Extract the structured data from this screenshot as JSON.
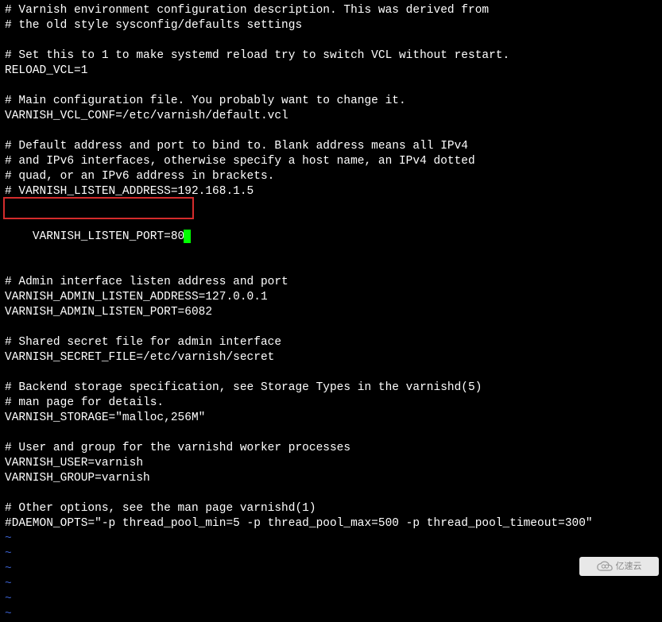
{
  "editor": {
    "lines": [
      "# Varnish environment configuration description. This was derived from",
      "# the old style sysconfig/defaults settings",
      "",
      "# Set this to 1 to make systemd reload try to switch VCL without restart.",
      "RELOAD_VCL=1",
      "",
      "# Main configuration file. You probably want to change it.",
      "VARNISH_VCL_CONF=/etc/varnish/default.vcl",
      "",
      "# Default address and port to bind to. Blank address means all IPv4",
      "# and IPv6 interfaces, otherwise specify a host name, an IPv4 dotted",
      "# quad, or an IPv6 address in brackets.",
      "# VARNISH_LISTEN_ADDRESS=192.168.1.5"
    ],
    "highlighted_line": "VARNISH_LISTEN_PORT=80",
    "lines_after": [
      "",
      "# Admin interface listen address and port",
      "VARNISH_ADMIN_LISTEN_ADDRESS=127.0.0.1",
      "VARNISH_ADMIN_LISTEN_PORT=6082",
      "",
      "# Shared secret file for admin interface",
      "VARNISH_SECRET_FILE=/etc/varnish/secret",
      "",
      "# Backend storage specification, see Storage Types in the varnishd(5)",
      "# man page for details.",
      "VARNISH_STORAGE=\"malloc,256M\"",
      "",
      "# User and group for the varnishd worker processes",
      "VARNISH_USER=varnish",
      "VARNISH_GROUP=varnish",
      "",
      "# Other options, see the man page varnishd(1)",
      "#DAEMON_OPTS=\"-p thread_pool_min=5 -p thread_pool_max=500 -p thread_pool_timeout=300\""
    ],
    "tilde_lines": [
      "~",
      "~",
      "~",
      "~",
      "~",
      "~"
    ]
  },
  "watermark": {
    "text": "亿速云"
  }
}
